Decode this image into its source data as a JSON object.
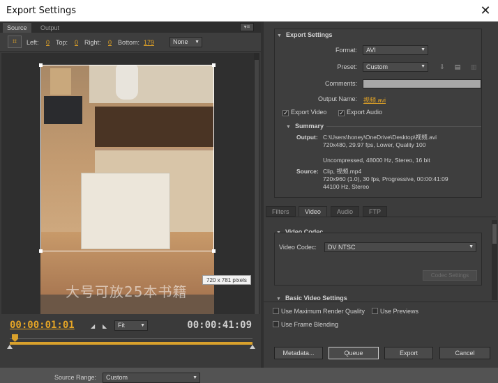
{
  "window": {
    "title": "Export Settings",
    "close_glyph": "✕"
  },
  "left_panel": {
    "tabs": [
      "Source",
      "Output"
    ],
    "crop": {
      "left_label": "Left:",
      "left_value": "0",
      "top_label": "Top:",
      "top_value": "0",
      "right_label": "Right:",
      "right_value": "0",
      "bottom_label": "Bottom:",
      "bottom_value": "179",
      "aspect_value": "None"
    },
    "preview": {
      "watermark_text": "大号可放25本书籍",
      "dimension_badge": "720 x 781 pixels"
    },
    "timeline": {
      "current_time": "00:00:01:01",
      "duration": "00:00:41:09",
      "zoom_value": "Fit",
      "source_range_label": "Source Range:",
      "source_range_value": "Custom",
      "playhead_fraction": 0.02
    }
  },
  "right_panel": {
    "export_settings": {
      "header": "Export Settings",
      "format_label": "Format:",
      "format_value": "AVI",
      "preset_label": "Preset:",
      "preset_value": "Custom",
      "comments_label": "Comments:",
      "comments_value": "",
      "output_name_label": "Output Name:",
      "output_name_value": "视频.avi",
      "export_video_label": "Export Video",
      "export_video_checked": true,
      "export_audio_label": "Export Audio",
      "export_audio_checked": true,
      "icons": [
        "save-preset-icon",
        "import-preset-icon",
        "delete-preset-icon"
      ]
    },
    "summary": {
      "header": "Summary",
      "output_label": "Output:",
      "output_lines": [
        "C:\\Users\\honey\\OneDrive\\Desktop\\视频.avi",
        "720x480, 29.97 fps, Lower, Quality 100",
        "",
        "Uncompressed, 48000 Hz, Stereo, 16 bit"
      ],
      "source_label": "Source:",
      "source_lines": [
        "Clip, 视频.mp4",
        "720x960 (1.0), 30 fps, Progressive, 00:00:41:09",
        "44100 Hz, Stereo"
      ]
    },
    "tabs": [
      "Filters",
      "Video",
      "Audio",
      "FTP"
    ],
    "active_tab": "Video",
    "video_codec": {
      "header": "Video Codec",
      "codec_label": "Video Codec:",
      "codec_value": "DV NTSC",
      "codec_settings_button": "Codec Settings"
    },
    "basic_video_header": "Basic Video Settings",
    "options": {
      "max_render_quality": "Use Maximum Render Quality",
      "use_previews": "Use Previews",
      "frame_blending": "Use Frame Blending"
    },
    "buttons": {
      "metadata": "Metadata...",
      "queue": "Queue",
      "export": "Export",
      "cancel": "Cancel"
    }
  },
  "colors": {
    "accent": "#e5a526",
    "panel": "#3c3c3c",
    "dark": "#2e2e2e"
  }
}
